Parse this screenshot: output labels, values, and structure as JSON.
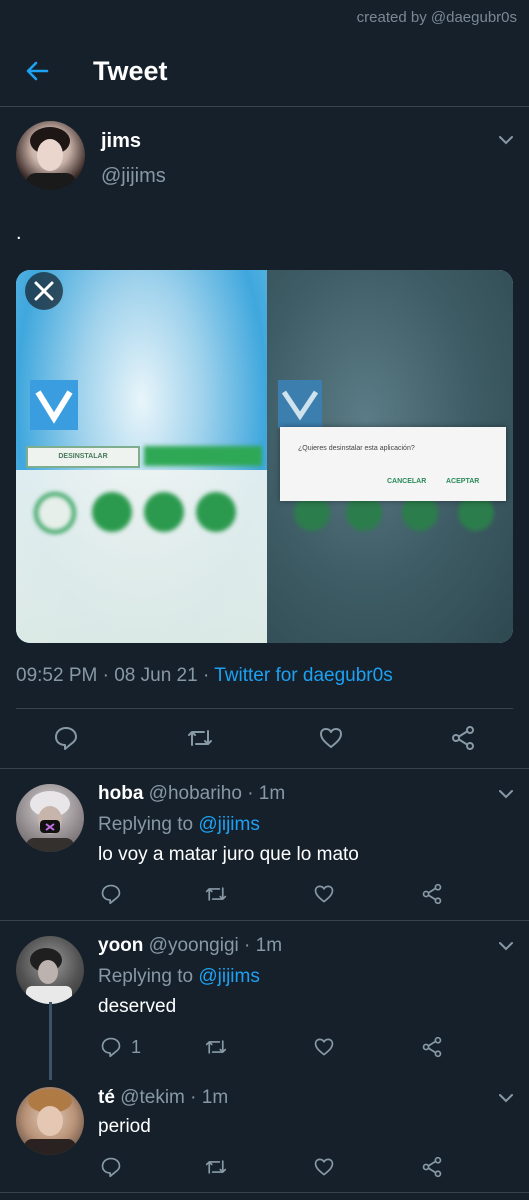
{
  "credit": "created by @daegubr0s",
  "header": {
    "title": "Tweet"
  },
  "tweet": {
    "name": "jims",
    "handle": "@jijims",
    "text": ".",
    "media": {
      "uninstall_button": "DESINSTALAR",
      "dialog_question": "¿Quieres desinstalar esta aplicación?",
      "dialog_cancel": "CANCELAR",
      "dialog_accept": "ACEPTAR"
    },
    "meta": {
      "time_date": "09:52 PM · 08 Jun 21 · ",
      "source": "Twitter for daegubr0s"
    }
  },
  "replies": [
    {
      "name": "hoba",
      "handle": "@hobariho",
      "time": " · 1m",
      "replying_prefix": "Replying to ",
      "replying_to": "@jijims",
      "text": "lo voy a matar juro que lo mato",
      "reply_count": ""
    },
    {
      "name": "yoon",
      "handle": "@yoongigi",
      "time": " · 1m",
      "replying_prefix": "Replying to ",
      "replying_to": "@jijims",
      "text": "deserved",
      "reply_count": "1"
    },
    {
      "name": "té",
      "handle": "@tekim",
      "time": " · 1m",
      "text": "period",
      "reply_count": ""
    }
  ],
  "icons": [
    "back-arrow-icon",
    "chevron-down-icon",
    "close-icon",
    "reply-icon",
    "retweet-icon",
    "like-icon",
    "share-icon"
  ]
}
